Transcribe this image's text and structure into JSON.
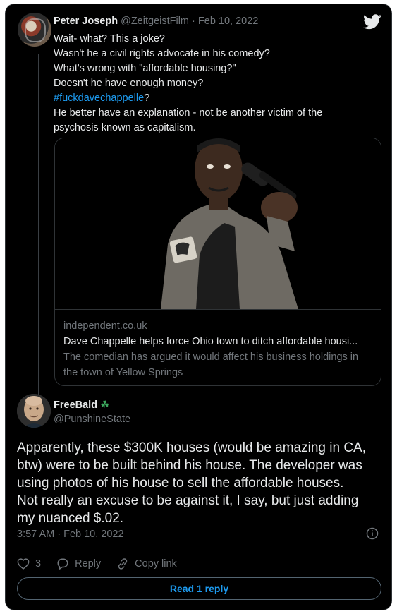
{
  "parent_tweet": {
    "name": "Peter Joseph",
    "handle_date": "@ZeitgeistFilm · Feb 10, 2022",
    "lines": [
      "Wait- what? This a joke?",
      "Wasn't he a civil rights advocate in his comedy?",
      "What's wrong with \"affordable housing?\"",
      "Doesn't he have enough money?"
    ],
    "hashtag": "#fuckdavechappelle",
    "hashtag_suffix": "?",
    "lines_after": [
      "He better have an explanation - not be another victim of the",
      "psychosis known as capitalism."
    ],
    "link_card": {
      "domain": "independent.co.uk",
      "title": "Dave Chappelle helps force Ohio town to ditch affordable housi...",
      "description": "The comedian has argued it would affect his business holdings in the town of Yellow Springs"
    }
  },
  "reply_tweet": {
    "name": "FreeBald",
    "name_emoji": "☘",
    "handle": "@PunshineState",
    "lines": [
      "Apparently, these $300K houses (would be amazing in CA,",
      "btw) were to be built behind his house. The developer was",
      "using photos of his house to sell the affordable houses.",
      "Not really an excuse to be against it, I say, but just adding",
      "my nuanced $.02."
    ],
    "timestamp": "3:57 AM · Feb 10, 2022",
    "like_count": "3",
    "reply_label": "Reply",
    "copy_link_label": "Copy link",
    "read_replies_label": "Read 1 reply"
  },
  "icons": {
    "brand": "twitter-bird-icon",
    "info": "info-icon",
    "like": "heart-icon",
    "reply": "speech-bubble-icon",
    "copy_link": "link-icon"
  },
  "colors": {
    "background": "#000000",
    "accent": "#1d9bf0",
    "muted": "#71767b",
    "text": "#e7e9ea",
    "clover": "#3ba55c"
  }
}
